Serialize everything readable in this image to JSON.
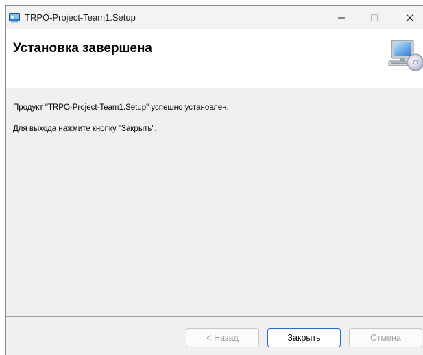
{
  "window": {
    "title": "TRPO-Project-Team1.Setup"
  },
  "banner": {
    "title": "Установка завершена"
  },
  "content": {
    "line1": "Продукт \"TRPO-Project-Team1.Setup\" успешно установлен.",
    "line2": "Для выхода нажмите кнопку \"Закрыть\"."
  },
  "buttons": {
    "back": "< Назад",
    "finish": "Закрыть",
    "cancel": "Отмена"
  },
  "icons": {
    "app": "installer-app-icon",
    "setup": "computer-cd-icon",
    "minimize": "minimize-icon",
    "maximize": "maximize-icon",
    "close": "close-icon"
  },
  "colors": {
    "focus_border": "#1a6ec7",
    "disabled_text": "#a0a0a0"
  }
}
